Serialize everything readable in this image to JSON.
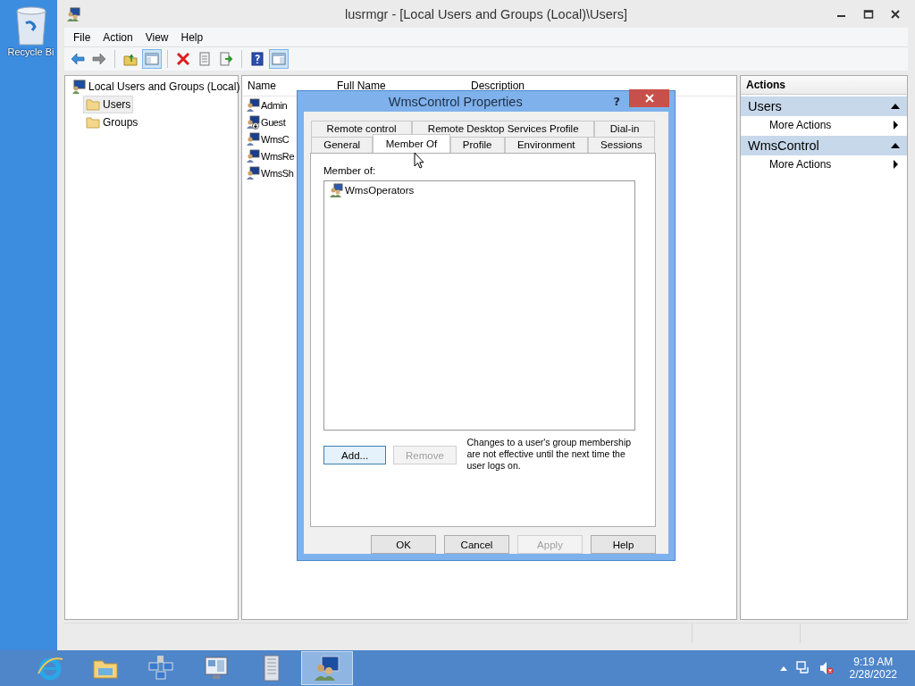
{
  "desktop": {
    "icons": [
      {
        "label": "Recycle Bi"
      }
    ]
  },
  "window": {
    "title": "lusrmgr - [Local Users and Groups (Local)\\Users]"
  },
  "menu": [
    "File",
    "Action",
    "View",
    "Help"
  ],
  "toolbar": [
    {
      "pressed": false
    },
    {
      "pressed": false
    },
    {
      "pressed": false
    },
    {
      "pressed": true
    },
    {
      "pressed": false
    },
    {
      "pressed": false
    },
    {
      "pressed": false
    },
    {
      "pressed": false
    },
    {
      "pressed": true
    }
  ],
  "tree": [
    {
      "label": "Local Users and Groups (Local)",
      "selected": false,
      "expanded": true,
      "children": [
        {
          "label": "Users",
          "selected": true
        },
        {
          "label": "Groups",
          "selected": false
        }
      ]
    }
  ],
  "list": {
    "columns": [
      "Name",
      "Full Name",
      "Description"
    ],
    "rows": [
      {
        "name": "Admin",
        "disabled": false
      },
      {
        "name": "Guest",
        "disabled": true
      },
      {
        "name": "WmsC",
        "disabled": false
      },
      {
        "name": "WmsRe",
        "disabled": false
      },
      {
        "name": "WmsSh",
        "disabled": false
      }
    ]
  },
  "actions": {
    "title": "Actions",
    "sections": [
      {
        "title": "Users",
        "expanded": true,
        "items": [
          "More Actions"
        ]
      },
      {
        "title": "WmsControl",
        "expanded": true,
        "items": [
          "More Actions"
        ]
      }
    ]
  },
  "dialog": {
    "title": "WmsControl Properties",
    "help": "?",
    "tab_rows": [
      [
        {
          "label": "Remote control",
          "selected": false
        },
        {
          "label": "Remote Desktop Services Profile",
          "selected": false
        },
        {
          "label": "Dial-in",
          "selected": false
        }
      ],
      [
        {
          "label": "General",
          "selected": false
        },
        {
          "label": "Member Of",
          "selected": true
        },
        {
          "label": "Profile",
          "selected": false
        },
        {
          "label": "Environment",
          "selected": false
        },
        {
          "label": "Sessions",
          "selected": false
        }
      ]
    ],
    "member_of_label": "Member of:",
    "groups": [
      {
        "name": "WmsOperators"
      }
    ],
    "buttons": [
      {
        "label": "Add...",
        "disabled": false
      },
      {
        "label": "Remove",
        "disabled": true
      }
    ],
    "note": "Changes to a user's group membership are not effective until the next time the user logs on.",
    "footer_buttons": [
      {
        "label": "OK",
        "disabled": false
      },
      {
        "label": "Cancel",
        "disabled": false
      },
      {
        "label": "Apply",
        "disabled": true
      },
      {
        "label": "Help",
        "disabled": false
      }
    ]
  },
  "taskbar": {
    "apps": [
      {
        "selected": false
      },
      {
        "selected": false
      },
      {
        "selected": false
      },
      {
        "selected": false
      },
      {
        "selected": false
      },
      {
        "selected": true
      }
    ],
    "time": "9:19 AM",
    "date": "2/28/2022"
  }
}
